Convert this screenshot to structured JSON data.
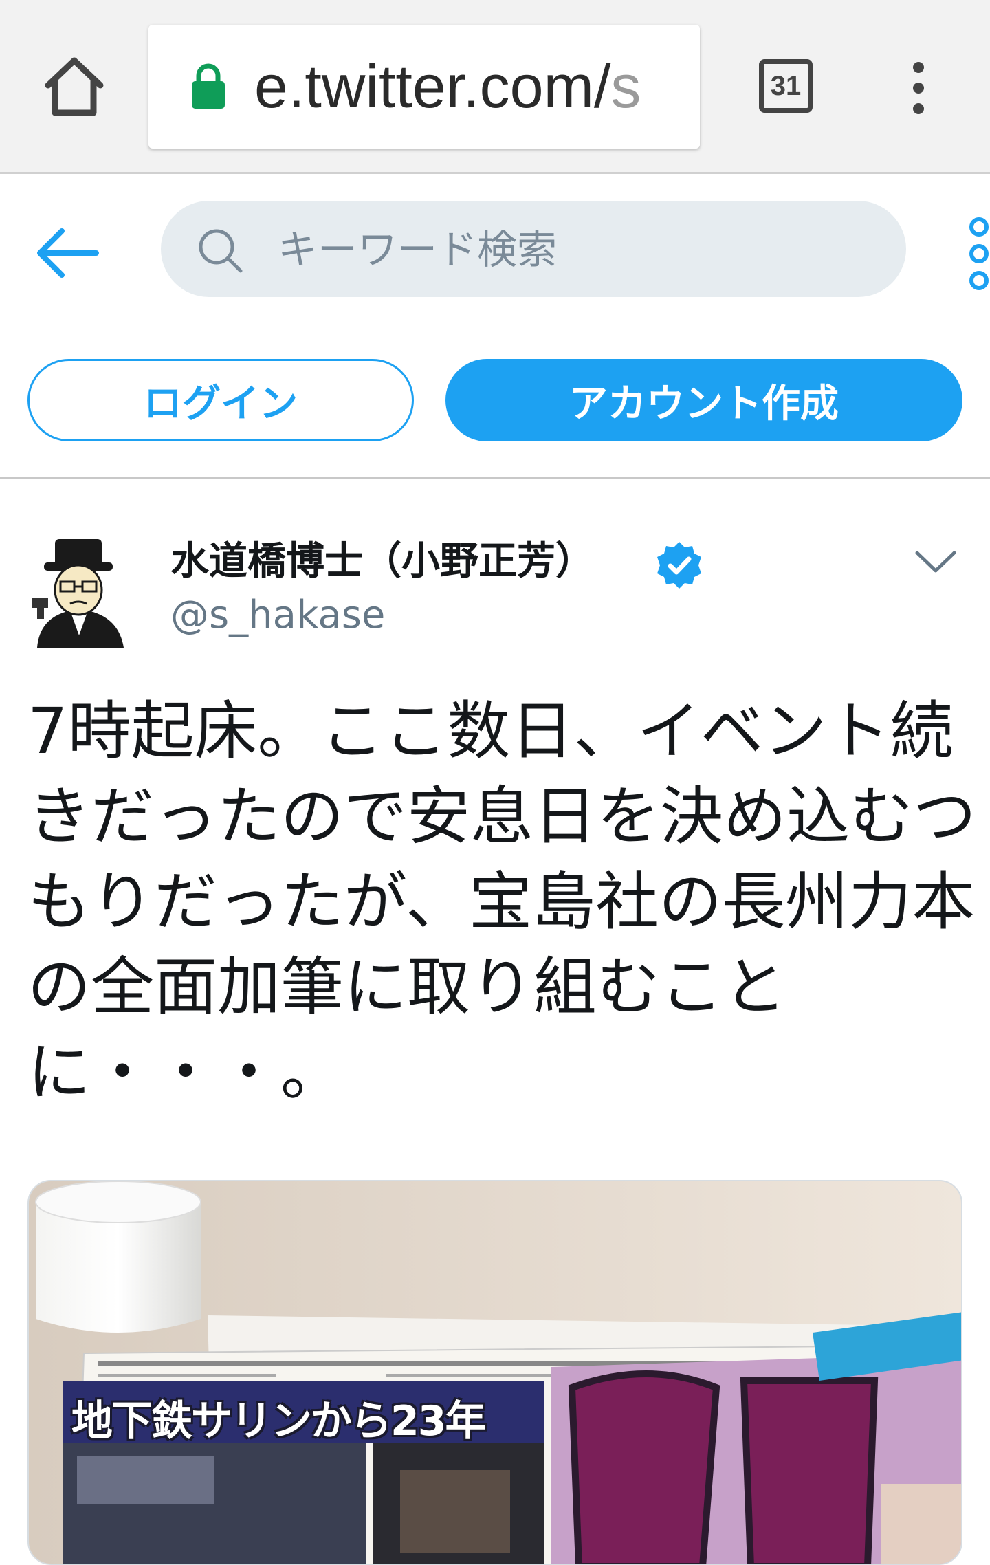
{
  "browser": {
    "url_visible": "e.twitter.com/",
    "url_cut": "s",
    "tab_count": "31",
    "icons": [
      "home-icon",
      "lock-icon",
      "tab-count",
      "more-vert-icon"
    ]
  },
  "header": {
    "search_placeholder": "キーワード検索",
    "login_label": "ログイン",
    "signup_label": "アカウント作成",
    "accent_color": "#1da1f2"
  },
  "tweet": {
    "display_name": "水道橋博士（小野正芳）",
    "username": "@s_hakase",
    "verified": true,
    "text": "7時起床。ここ数日、イベント続きだったので安息日を決め込むつもりだったが、宝島社の長州力本の全面加筆に取り組むことに・・・。"
  },
  "photo": {
    "headline": "地下鉄サリンから23年"
  }
}
